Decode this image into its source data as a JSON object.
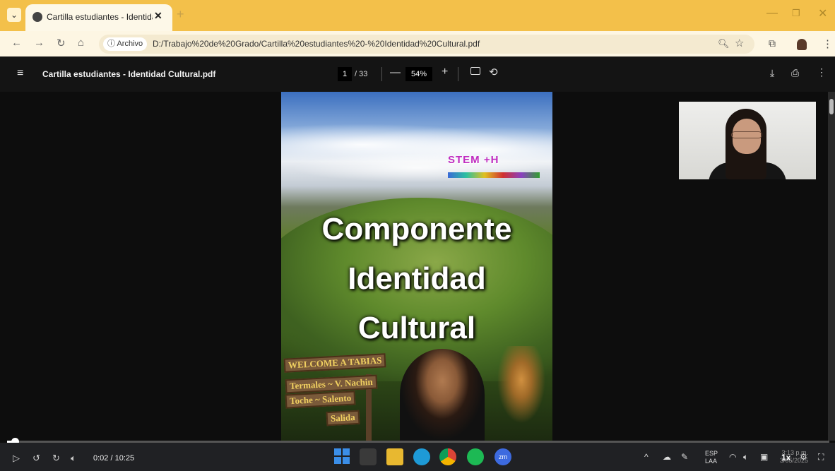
{
  "browser": {
    "tab_title": "Cartilla estudiantes - Identidad",
    "new_tab": "+",
    "info_chip": "ⓘ Archivo",
    "url": "D:/Trabajo%20de%20Grado/Cartilla%20estudiantes%20-%20Identidad%20Cultural.pdf"
  },
  "pdf": {
    "title": "Cartilla estudiantes - Identidad Cultural.pdf",
    "page_current": "1",
    "page_total": "/ 33",
    "zoom": "54%"
  },
  "cover": {
    "logo_text": "STEM +H",
    "title_line1": "Componente",
    "title_line2": "Identidad",
    "title_line3": "Cultural",
    "sign_lines": [
      "WELCOME A TABIAS",
      "Termales ~ V. Nachin",
      "Toche ~ Salento",
      "Salida"
    ]
  },
  "video": {
    "time": "0:02 / 10:25",
    "progress_fraction": 0.003,
    "speed": "1x"
  },
  "system": {
    "lang_line1": "ESP",
    "lang_line2": "LAA",
    "clock_time": "3:13 p.m.",
    "clock_date": "3/05/2025"
  }
}
